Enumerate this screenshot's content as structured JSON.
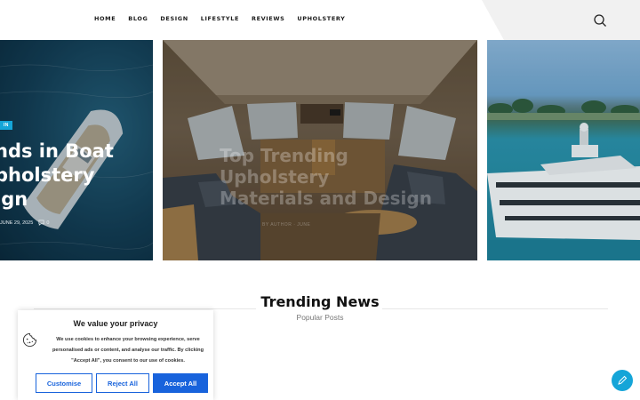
{
  "nav": {
    "items": [
      {
        "label": "HOME"
      },
      {
        "label": "BLOG"
      },
      {
        "label": "DESIGN"
      },
      {
        "label": "LIFESTYLE"
      },
      {
        "label": "REVIEWS"
      },
      {
        "label": "UPHOLSTERY"
      }
    ],
    "search_icon": "search-icon"
  },
  "slider": {
    "left": {
      "tag": "IN",
      "title_lines": [
        "nds in Boat",
        "pholstery",
        "ign"
      ],
      "date": "JUNE 29, 2025",
      "comments": "0"
    },
    "center": {
      "title_lines": [
        "Top Trending Upholstery",
        "Materials and Design"
      ],
      "meta": "BY AUTHOR  ·  JUNE"
    }
  },
  "trending": {
    "title": "Trending News",
    "subtitle": "Popular Posts"
  },
  "cookie": {
    "title": "We value your privacy",
    "text": "We use cookies to enhance your browsing experience, serve personalised ads or content, and analyse our traffic. By clicking \"Accept All\", you consent to our use of cookies.",
    "buttons": {
      "customise": "Customise",
      "reject": "Reject All",
      "accept": "Accept All"
    },
    "icon": "cookie-icon"
  },
  "fab": {
    "icon": "pen-icon"
  },
  "colors": {
    "accent": "#15a5d8",
    "cookie_blue": "#1863dc"
  }
}
